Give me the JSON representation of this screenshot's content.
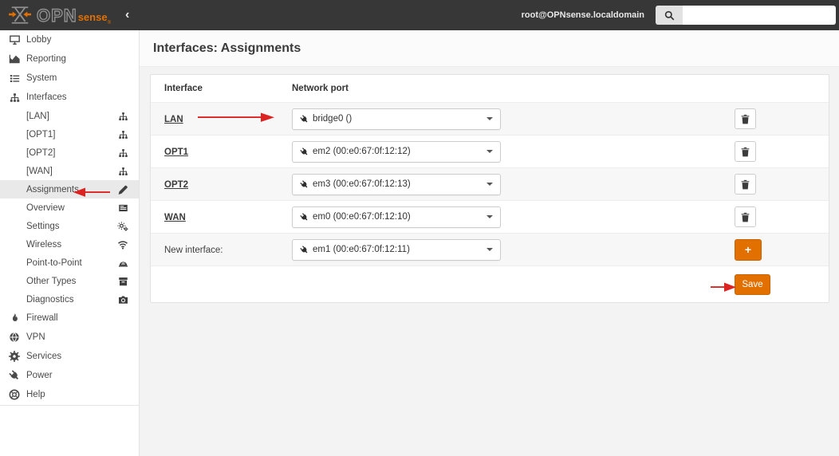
{
  "header": {
    "brand": {
      "opn": "OPN",
      "sense": "sense",
      "reg": "®"
    },
    "collapse_icon": "‹",
    "user": "root@OPNsense.localdomain",
    "search": {
      "value": "",
      "placeholder": ""
    }
  },
  "sidebar": {
    "items": [
      {
        "label": "Lobby",
        "icon": "desktop-icon"
      },
      {
        "label": "Reporting",
        "icon": "area-chart-icon"
      },
      {
        "label": "System",
        "icon": "list-icon"
      },
      {
        "label": "Interfaces",
        "icon": "sitemap-icon",
        "expanded": true,
        "children": [
          {
            "label": "[LAN]",
            "icon": "sitemap-icon"
          },
          {
            "label": "[OPT1]",
            "icon": "sitemap-icon"
          },
          {
            "label": "[OPT2]",
            "icon": "sitemap-icon"
          },
          {
            "label": "[WAN]",
            "icon": "sitemap-icon"
          },
          {
            "label": "Assignments",
            "icon": "pencil-icon",
            "active": true
          },
          {
            "label": "Overview",
            "icon": "newspaper-icon"
          },
          {
            "label": "Settings",
            "icon": "cogs-icon"
          },
          {
            "label": "Wireless",
            "icon": "wifi-icon"
          },
          {
            "label": "Point-to-Point",
            "icon": "modem-icon"
          },
          {
            "label": "Other Types",
            "icon": "archive-icon"
          },
          {
            "label": "Diagnostics",
            "icon": "camera-icon"
          }
        ]
      },
      {
        "label": "Firewall",
        "icon": "fire-icon"
      },
      {
        "label": "VPN",
        "icon": "globe-icon"
      },
      {
        "label": "Services",
        "icon": "gear-icon"
      },
      {
        "label": "Power",
        "icon": "plug-icon"
      },
      {
        "label": "Help",
        "icon": "life-ring-icon"
      }
    ]
  },
  "main": {
    "title": "Interfaces: Assignments",
    "table": {
      "columns": {
        "interface": "Interface",
        "port": "Network port"
      },
      "rows": [
        {
          "interface": "LAN",
          "port": "bridge0 ()",
          "is_link": true
        },
        {
          "interface": "OPT1",
          "port": "em2 (00:e0:67:0f:12:12)",
          "is_link": true
        },
        {
          "interface": "OPT2",
          "port": "em3 (00:e0:67:0f:12:13)",
          "is_link": true
        },
        {
          "interface": "WAN",
          "port": "em0 (00:e0:67:0f:12:10)",
          "is_link": true
        },
        {
          "interface": "New interface:",
          "port": "em1 (00:e0:67:0f:12:11)",
          "is_link": false
        }
      ],
      "add_label": "+",
      "save_label": "Save"
    }
  },
  "colors": {
    "accent_orange": "#e17000",
    "header_bg": "#373737",
    "annotation_arrow_red": "#dd2222",
    "active_item_bg": "#e9e9e9"
  }
}
